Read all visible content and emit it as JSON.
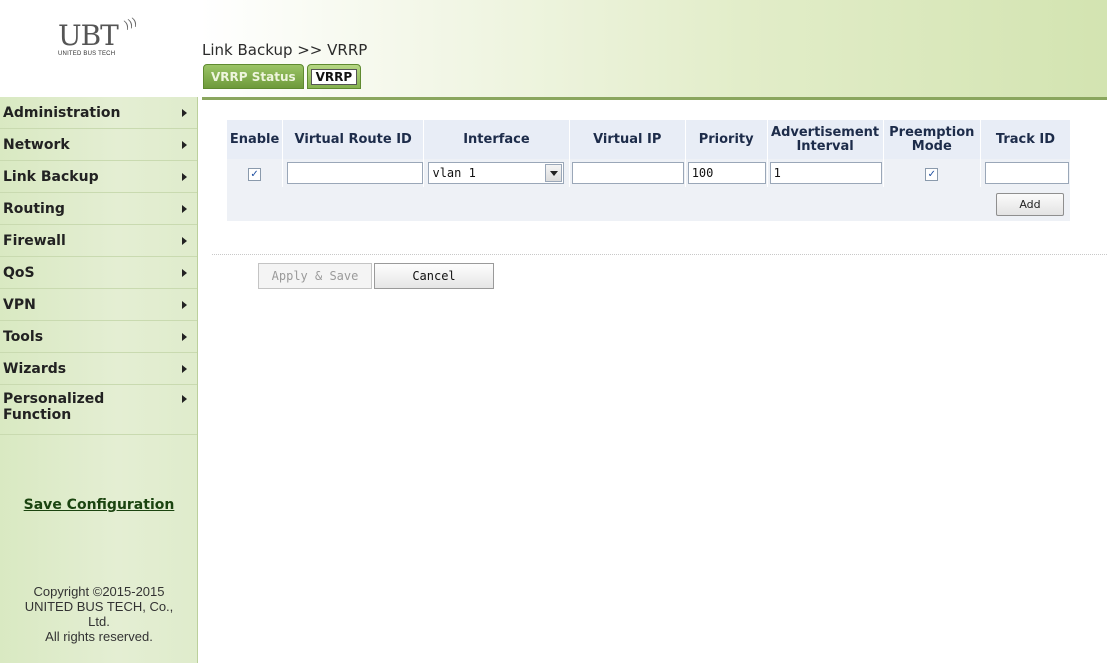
{
  "brand": {
    "logo_text": "UBT",
    "logo_subtitle": "UNITED BUS TECH"
  },
  "header": {
    "breadcrumb": "Link Backup >> VRRP",
    "tabs": [
      {
        "label": "VRRP Status",
        "active": false
      },
      {
        "label": "VRRP",
        "active": true
      }
    ]
  },
  "sidebar": {
    "items": [
      {
        "label": "Administration"
      },
      {
        "label": "Network"
      },
      {
        "label": "Link Backup"
      },
      {
        "label": "Routing"
      },
      {
        "label": "Firewall"
      },
      {
        "label": "QoS"
      },
      {
        "label": "VPN"
      },
      {
        "label": "Tools"
      },
      {
        "label": "Wizards"
      },
      {
        "label": "Personalized Function"
      }
    ],
    "save_configuration": "Save Configuration",
    "copyright_line1": "Copyright ©2015-2015",
    "copyright_line2": "UNITED BUS TECH, Co.,",
    "copyright_line3": "Ltd.",
    "copyright_line4": "All rights reserved."
  },
  "vrrp_table": {
    "columns": {
      "enable": "Enable",
      "virtual_route_id": "Virtual Route ID",
      "interface": "Interface",
      "virtual_ip": "Virtual IP",
      "priority": "Priority",
      "advertisement_interval": "Advertisement Interval",
      "preemption_mode": "Preemption Mode",
      "track_id": "Track ID"
    },
    "row": {
      "enable_checked": true,
      "virtual_route_id": "",
      "interface": "vlan 1",
      "virtual_ip": "",
      "priority": "100",
      "advertisement_interval": "1",
      "preemption_checked": true,
      "track_id": ""
    },
    "add_label": "Add"
  },
  "actions": {
    "apply_save": "Apply & Save",
    "cancel": "Cancel"
  },
  "check_glyph": "✓"
}
